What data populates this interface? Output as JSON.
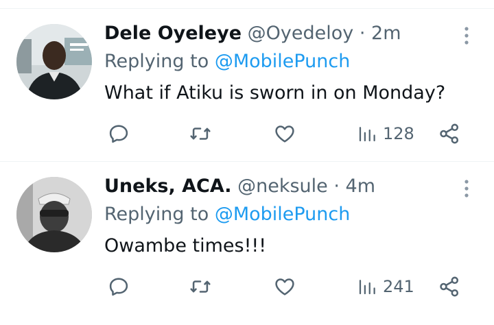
{
  "tweets": [
    {
      "name": "Dele Oyeleye",
      "handle": "@Oyedeloy",
      "separator": "·",
      "time": "2m",
      "replying_prefix": "Replying to",
      "replying_to": "@MobilePunch",
      "text": "What if Atiku is sworn in on Monday?",
      "views": "128",
      "icons": [
        "reply-icon",
        "retweet-icon",
        "like-icon",
        "views-icon",
        "share-icon",
        "more-icon"
      ]
    },
    {
      "name": "Uneks, ACA.",
      "handle": "@neksule",
      "separator": "·",
      "time": "4m",
      "replying_prefix": "Replying to",
      "replying_to": "@MobilePunch",
      "text": "Owambe times!!!",
      "views": "241",
      "icons": [
        "reply-icon",
        "retweet-icon",
        "like-icon",
        "views-icon",
        "share-icon",
        "more-icon"
      ]
    }
  ],
  "colors": {
    "text": "#0f1419",
    "secondary": "#536471",
    "link": "#1d9bf0",
    "divider": "#eff3f4"
  }
}
